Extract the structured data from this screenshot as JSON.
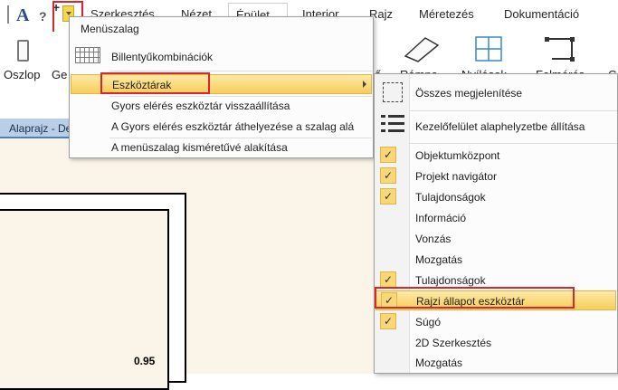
{
  "tabs": [
    "Szerkesztés",
    "Nézet",
    "Épület",
    "Interior",
    "Rajz",
    "Méretezés",
    "Dokumentáció"
  ],
  "active_tab": "Épület",
  "ribbon": {
    "oszlop": "Oszlop",
    "ge": "Ge",
    "ramp_partial": "Rámpa",
    "nyilasok_partial": "Nyílások",
    "felmeres_partial": "Felmérés",
    "side_letter": "ő",
    "right_letter": "C"
  },
  "document_tab": "Alaprajz - De",
  "dimension": "0.95",
  "menu": {
    "title": "Menüszalag",
    "items": [
      "Billentyűkombinációk",
      "Eszköztárak",
      "Gyors elérés eszköztár visszaállítása",
      "A Gyors elérés eszköztár áthelyezése a szalag alá",
      "A menüszalag kisméretűvé alakítása"
    ]
  },
  "submenu": {
    "items": [
      {
        "label": "Összes megjelenítése",
        "checked": false
      },
      {
        "label": "Kezelőfelület alaphelyzetbe állítása",
        "checked": false
      },
      {
        "label": "Objektumközpont",
        "checked": true
      },
      {
        "label": "Projekt navigátor",
        "checked": true
      },
      {
        "label": "Tulajdonságok",
        "checked": true
      },
      {
        "label": "Információ",
        "checked": false
      },
      {
        "label": "Vonzás",
        "checked": false
      },
      {
        "label": "Mozgatás",
        "checked": false
      },
      {
        "label": "Tulajdonságok",
        "checked": true
      },
      {
        "label": "Rajzi állapot eszköztár",
        "checked": true
      },
      {
        "label": "Súgó",
        "checked": true
      },
      {
        "label": "2D Szerkesztés",
        "checked": false
      },
      {
        "label": "Mozgatás",
        "checked": false
      }
    ]
  },
  "colors": {
    "highlight": "#f7cd5a",
    "annotation_red": "#d9262c",
    "document_tab": "#b9cfe8",
    "canvas": "#fbf4e8"
  }
}
